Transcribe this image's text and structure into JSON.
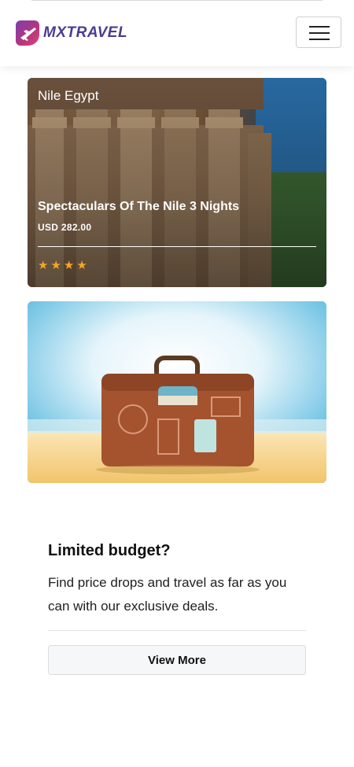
{
  "header": {
    "brand": "MXTRAVEL",
    "logo_icon": "airplane-logo-icon",
    "menu_icon": "hamburger-menu-icon"
  },
  "tour": {
    "location": "Nile Egypt",
    "title": "Spectaculars Of The Nile 3 Nights",
    "price": "USD 282.00",
    "rating": 4,
    "star_icon": "star-icon",
    "star_color": "#f5a623"
  },
  "promo": {
    "image_icon": "suitcase-illustration",
    "title": "Limited budget?",
    "description": "Find price drops and travel as far as you can with our exclusive deals.",
    "button_label": "View More"
  },
  "colors": {
    "brand_text": "#4b3b8f",
    "logo_gradient_start": "#7a3fb0",
    "logo_gradient_end": "#e0457b"
  }
}
